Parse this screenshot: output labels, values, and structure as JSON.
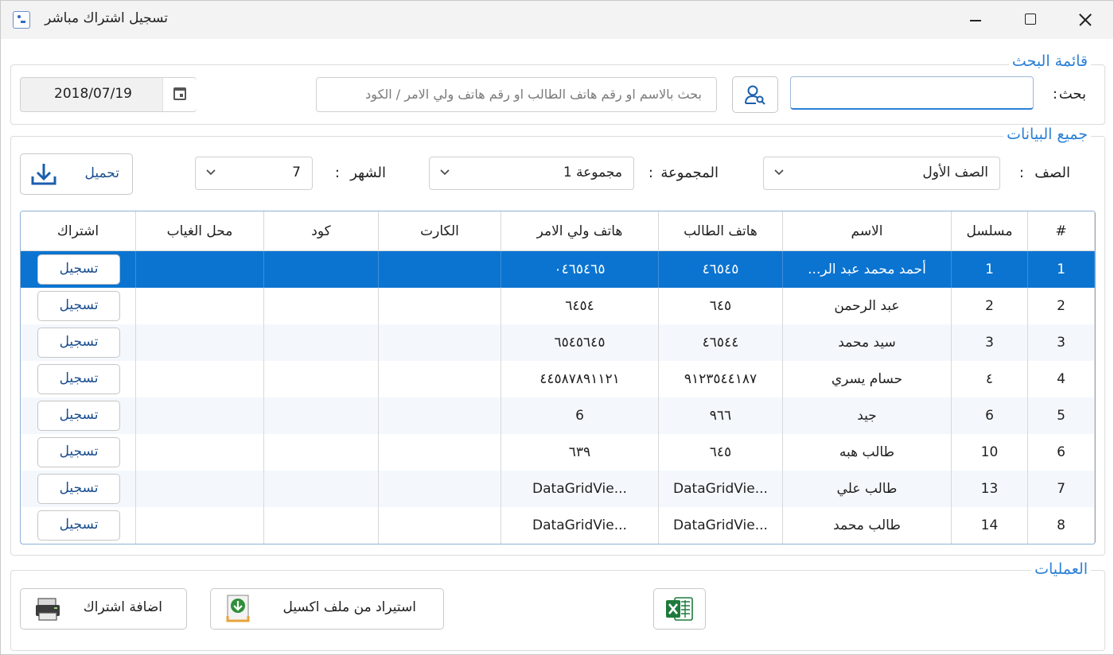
{
  "window": {
    "title": "تسجيل اشتراك مباشر",
    "icon": "app-icon"
  },
  "search_group": {
    "title": "قائمة البحث",
    "search_label": "بحث",
    "colon": ":",
    "search_value": "",
    "hint_text": "بحث بالاسم او رقم هاتف الطالب او رقم هاتف ولي الامر / الكود",
    "date_value": "2018/07/19"
  },
  "data_group": {
    "title": "جميع البيانات",
    "download_label": "تحميل",
    "grade_label": "الصف",
    "grade_value": "الصف الأول",
    "group_label": "المجموعة",
    "group_value": "مجموعة 1",
    "month_label": "الشهر",
    "month_value": "7"
  },
  "grid": {
    "columns": [
      "#",
      "مسلسل",
      "الاسم",
      "هاتف الطالب",
      "هاتف ولي الامر",
      "الكارت",
      "كود",
      "محل الغياب",
      "اشتراك"
    ],
    "button_label": "تسجيل",
    "rows": [
      {
        "num": "1",
        "serial": "1",
        "name": "أحمد محمد عبد الر...",
        "student_phone": "٤٦٥٤٥",
        "parent_phone": "٠٤٦٥٤٦٥"
      },
      {
        "num": "2",
        "serial": "2",
        "name": "عبد الرحمن",
        "student_phone": "٦٤٥",
        "parent_phone": "٦٤٥٤"
      },
      {
        "num": "3",
        "serial": "3",
        "name": "سيد محمد",
        "student_phone": "٤٦٥٤٤",
        "parent_phone": "٦٥٤٥٦٤٥"
      },
      {
        "num": "4",
        "serial": "٤",
        "name": "حسام يسري",
        "student_phone": "٩١٢٣٥٤٤١٨٧",
        "parent_phone": "٤٤٥٨٧٨٩١١٢١"
      },
      {
        "num": "5",
        "serial": "6",
        "name": "جيد",
        "student_phone": "٩٦٦",
        "parent_phone": "6"
      },
      {
        "num": "6",
        "serial": "10",
        "name": "طالب هبه",
        "student_phone": "٦٤٥",
        "parent_phone": "٦٣٩"
      },
      {
        "num": "7",
        "serial": "13",
        "name": "طالب علي",
        "student_phone": "...DataGridVie",
        "parent_phone": "...DataGridVie"
      },
      {
        "num": "8",
        "serial": "14",
        "name": "طالب محمد",
        "student_phone": "...DataGridVie",
        "parent_phone": "...DataGridVie"
      }
    ],
    "selected_row": 1
  },
  "operations_group": {
    "title": "العمليات",
    "add_label": "اضافة اشتراك",
    "import_label": "استيراد من ملف اكسيل"
  },
  "colors": {
    "accent": "#2a7fd6",
    "selected_row": "#0b74d1",
    "excel_green": "#1e7a3c"
  }
}
